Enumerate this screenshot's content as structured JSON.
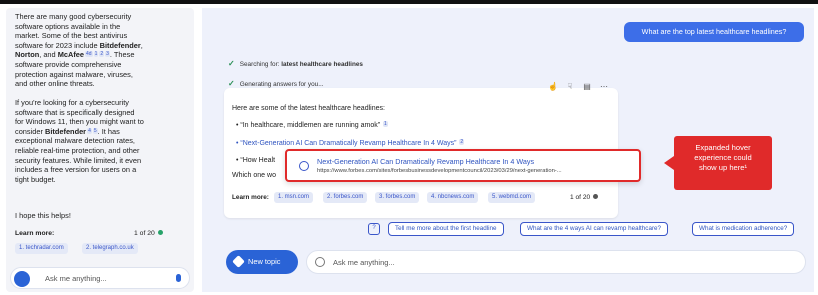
{
  "left_panel": {
    "para1": [
      "There are many good cybersecurity",
      "software options available in the",
      "market. Some of the best antivirus",
      "software for 2023 include ",
      "Bitdefender",
      ",",
      "Norton",
      ", and ",
      "McAfee",
      ". These",
      "software provide comprehensive",
      "protection against malware, viruses,",
      "and other online threats."
    ],
    "para1_lines": [
      "There are many good cybersecurity",
      "software options available in the",
      "market. Some of the best antivirus"
    ],
    "para1_line4_pre": "software for 2023 include ",
    "para1_line4_bold": "Bitdefender",
    "para1_line4_post": ",",
    "para1_line5_bold1": "Norton",
    "para1_line5_mid": ", and ",
    "para1_line5_bold2": "McAfee",
    "para1_cites": [
      "4d",
      "1",
      "2",
      "3"
    ],
    "para1_line5_post": ". These",
    "para1_tail": [
      "software provide comprehensive",
      "protection against malware, viruses,",
      "and other online threats."
    ],
    "para2_lines": [
      "If you're looking for a cybersecurity",
      "software that is specifically designed",
      "for Windows 11, then you might want to"
    ],
    "para2_line4_pre": "consider ",
    "para2_line4_bold": "Bitdefender",
    "para2_cites": [
      "4",
      "5"
    ],
    "para2_line4_post": ". It has",
    "para2_tail": [
      "exceptional malware detection rates,",
      "reliable real-time protection, and other",
      "security features. While limited, it even",
      "includes a free version for users on a",
      "tight budget."
    ],
    "closing": "I hope this helps!",
    "learn_more": "Learn more:",
    "count": "1 of 20",
    "chips": [
      "1. techradar.com",
      "2. telegraph.co.uk"
    ],
    "ask_placeholder": "Ask me anything..."
  },
  "right_panel": {
    "user_query": "What are the top latest healthcare headlines?",
    "status1_pre": "Searching for: ",
    "status1_bold": "latest healthcare headlines",
    "status2": "Generating answers for you...",
    "intro": "Here are some of the latest healthcare headlines:",
    "bullet1": "• “In healthcare, middlemen are running amok”",
    "bullet1_cite": "1",
    "bullet2": "• “Next-Generation AI Can Dramatically Revamp Healthcare In 4 Ways”",
    "bullet2_cite": "2",
    "bullet3": "• “How Healt",
    "which": "Which one wo",
    "learn_more": "Learn more:",
    "chips": [
      "1. msn.com",
      "2. forbes.com",
      "3. forbes.com",
      "4. nbcnews.com",
      "5. webmd.com"
    ],
    "count": "1 of 20",
    "hover_title": "Next-Generation AI Can Dramatically Revamp Healthcare In 4 Ways",
    "hover_url": "https://www.forbes.com/sites/forbesbusinessdevelopmentcouncil/2023/03/29/next-generation-...",
    "callout": [
      "Expanded hover",
      "experience could",
      "show up here¹"
    ],
    "suggestions": [
      "Tell me more about the first headline",
      "What are the 4 ways AI can revamp healthcare?",
      "What is medication adherence?"
    ],
    "new_topic": "New topic",
    "ask_placeholder": "Ask me anything..."
  },
  "colors": {
    "accent": "#2a63d6",
    "callout": "#e02a2a",
    "link": "#2f54c0",
    "check": "#2a8f55"
  }
}
